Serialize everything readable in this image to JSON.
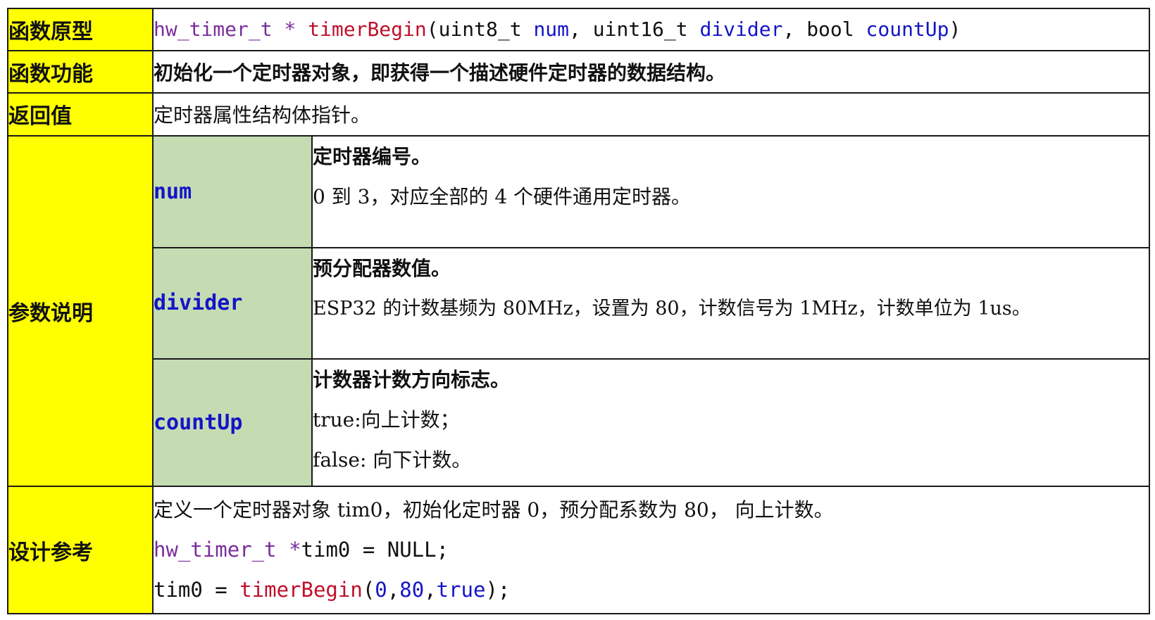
{
  "rows": {
    "prototype": {
      "label": "函数原型",
      "type": "hw_timer_t",
      "star": " * ",
      "fn": "timerBegin",
      "open": "(",
      "p1_type": "uint8_t ",
      "p1": "num",
      "sep1": ", ",
      "p2_type": "uint16_t ",
      "p2": "divider",
      "sep2": ", ",
      "p3_type": "bool ",
      "p3": "countUp",
      "close": ")"
    },
    "function": {
      "label": "函数功能",
      "text": "初始化一个定时器对象，即获得一个描述硬件定时器的数据结构。"
    },
    "return": {
      "label": "返回值",
      "text": "定时器属性结构体指针。"
    },
    "params": {
      "label": "参数说明",
      "items": [
        {
          "name": "num",
          "title": "定时器编号。",
          "lines": [
            "0 到 3，对应全部的 4 个硬件通用定时器。"
          ]
        },
        {
          "name": "divider",
          "title": "预分配器数值。",
          "lines": [
            "ESP32 的计数基频为 80MHz，设置为 80，计数信号为 1MHz，计数单位为 1us。"
          ]
        },
        {
          "name": "countUp",
          "title": "计数器计数方向标志。",
          "lines": [
            "true:向上计数；",
            "false: 向下计数。"
          ]
        }
      ]
    },
    "design": {
      "label": "设计参考",
      "desc": "定义一个定时器对象 tim0，初始化定时器 0，预分配系数为 80， 向上计数。",
      "code1": {
        "type": "hw_timer_t",
        "star": " *",
        "rest": "tim0 = NULL;"
      },
      "code2": {
        "pre": "tim0 = ",
        "fn": "timerBegin",
        "open": "(",
        "a1": "0",
        "c1": ",",
        "a2": "80",
        "c2": ",",
        "a3": "true",
        "close": ");"
      }
    }
  },
  "colors": {
    "header_bg": "#ffff00",
    "param_bg": "#c5dcb3",
    "type_color": "#7a2e9e",
    "function_color": "#c0102a",
    "variable_color": "#1414c8"
  }
}
